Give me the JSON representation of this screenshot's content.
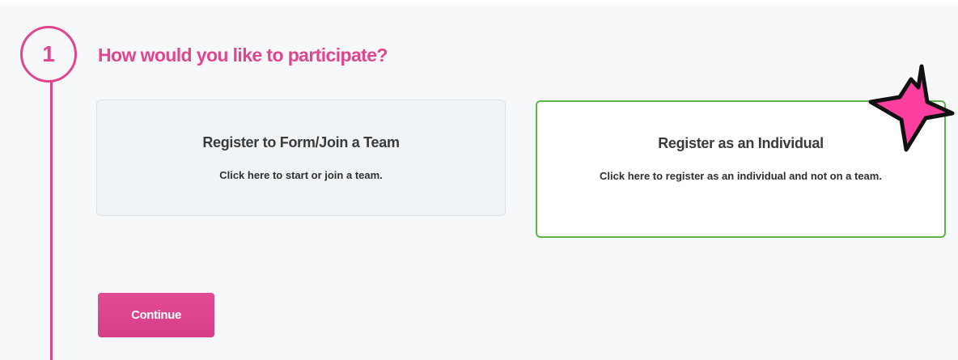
{
  "step": {
    "number": "1",
    "title": "How would you like to participate?"
  },
  "options": [
    {
      "title": "Register to Form/Join a Team",
      "description": "Click here to start or join a team.",
      "selected": false
    },
    {
      "title": "Register as an Individual",
      "description": "Click here to register as an individual and not on a team.",
      "selected": true
    }
  ],
  "actions": {
    "continue_label": "Continue"
  },
  "colors": {
    "accent": "#e0458f",
    "selected_border": "#5db54a",
    "star_fill": "#ff3fa0"
  },
  "decorations": {
    "highlight_icon": "star-icon"
  }
}
